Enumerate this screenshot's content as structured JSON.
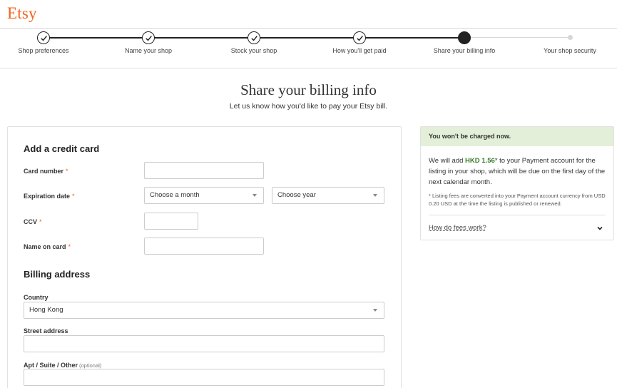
{
  "header": {
    "logo": "Etsy"
  },
  "steps": [
    {
      "label": "Shop preferences",
      "state": "done"
    },
    {
      "label": "Name your shop",
      "state": "done"
    },
    {
      "label": "Stock your shop",
      "state": "done"
    },
    {
      "label": "How you'll get paid",
      "state": "done"
    },
    {
      "label": "Share your billing info",
      "state": "current"
    },
    {
      "label": "Your shop security",
      "state": "future"
    }
  ],
  "page": {
    "title": "Share your billing info",
    "subtitle": "Let us know how you'd like to pay your Etsy bill."
  },
  "credit_card": {
    "title": "Add a credit card",
    "card_number_label": "Card number",
    "card_number_value": "",
    "expiration_label": "Expiration date",
    "month_value": "Choose a month",
    "year_value": "Choose year",
    "ccv_label": "CCV",
    "ccv_value": "",
    "name_label": "Name on card",
    "name_value": "",
    "required_mark": "*"
  },
  "billing": {
    "title": "Billing address",
    "country_label": "Country",
    "country_value": "Hong Kong",
    "street_label": "Street address",
    "street_value": "",
    "apt_label": "Apt / Suite / Other",
    "apt_optional": "(optional)",
    "apt_value": ""
  },
  "info": {
    "banner": "You won't be charged now.",
    "body_prefix": "We will add ",
    "amount": "HKD 1.56",
    "body_suffix": "* to your Payment account for the listing in your shop, which will be due on the first day of the next calendar month.",
    "note": "* Listing fees are converted into your Payment account currency from USD 0.20 USD at the time the listing is published or renewed.",
    "fees_link": "How do fees work?"
  },
  "colors": {
    "brand": "#f1641e",
    "banner_bg": "#e3efd9",
    "amount": "#3a7d2b"
  }
}
